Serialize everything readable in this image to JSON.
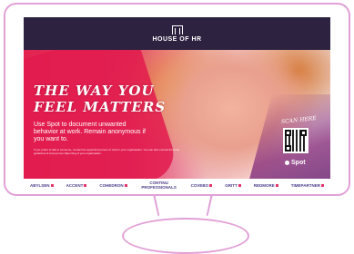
{
  "logo": {
    "name": "HOUSE OF HR",
    "icon": "building-icon"
  },
  "headline": {
    "line1": "THE WAY YOU",
    "line2": "FEEL MATTERS"
  },
  "subtext": "Use Spot to document unwanted behavior at work. Remain anonymous if you want to.",
  "fine_print": "If you prefer to talk to someone, contact the appointed person of trust in your organisation. You can also consult the local guidelines & Anonymous Reporting of your organisation.",
  "scan_label": "SCAN HERE",
  "spot": {
    "label": "Spot",
    "icon": "spot-dot-icon"
  },
  "brands": [
    {
      "label": "ABYLSEN"
    },
    {
      "label": "ACCENT"
    },
    {
      "label": "COHEDRON"
    },
    {
      "label": "CONTINU PROFESSIONALS"
    },
    {
      "label": "COVEBO"
    },
    {
      "label": "GRITT"
    },
    {
      "label": "REDMORE"
    },
    {
      "label": "TIMEPARTNER"
    }
  ],
  "colors": {
    "accent": "#e2234f",
    "header": "#2d2240",
    "monitor": "#e2a0d6",
    "brand_text": "#4a3a8a"
  }
}
